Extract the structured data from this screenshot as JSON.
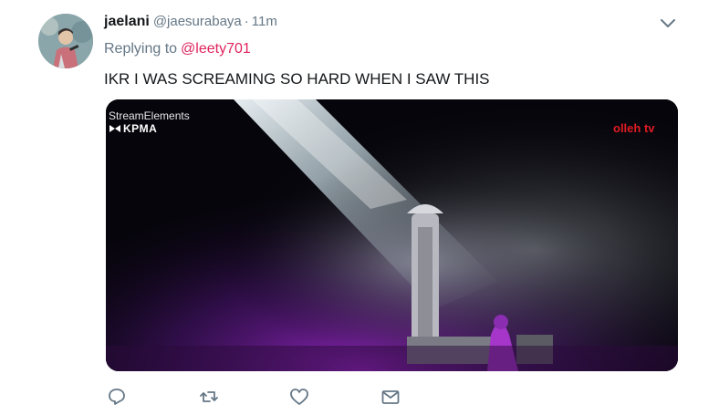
{
  "tweet": {
    "display_name": "jaelani",
    "handle": "@jaesurabaya",
    "separator": "·",
    "time": "11m",
    "replying_prefix": "Replying to",
    "replying_to": "@leety701",
    "text": "IKR I WAS SCREAMING SO HARD WHEN I SAW THIS"
  },
  "media": {
    "watermark_top_left": "StreamElements",
    "watermark_logo_text": "KPMA",
    "watermark_top_right": "olleh tv"
  },
  "icons": {
    "caret": "chevron-down-icon",
    "reply": "reply-icon",
    "retweet": "retweet-icon",
    "like": "heart-icon",
    "message": "envelope-icon"
  },
  "colors": {
    "text": "#14171a",
    "secondary": "#657786",
    "mention": "#e0245e",
    "icon": "#657786",
    "olleh_red": "#e11b23"
  }
}
